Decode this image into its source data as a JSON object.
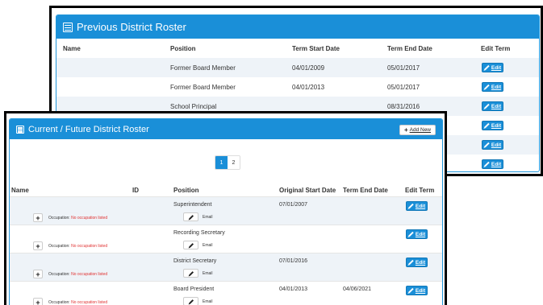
{
  "previous_roster": {
    "title": "Previous District Roster",
    "columns": [
      "Name",
      "Position",
      "Term Start Date",
      "Term End Date",
      "Edit Term"
    ],
    "rows": [
      {
        "name": "",
        "position": "Former Board Member",
        "start": "04/01/2009",
        "end": "05/01/2017",
        "edit": "Edit"
      },
      {
        "name": "",
        "position": "Former Board Member",
        "start": "04/01/2013",
        "end": "05/01/2017",
        "edit": "Edit"
      },
      {
        "name": "",
        "position": "School Principal",
        "start": "",
        "end": "08/31/2016",
        "edit": "Edit"
      },
      {
        "edit": "Edit"
      },
      {
        "edit": "Edit"
      },
      {
        "edit": "Edit"
      }
    ]
  },
  "current_roster": {
    "title": "Current / Future District Roster",
    "add_new_label": "Add New",
    "pagination": [
      "1",
      "2"
    ],
    "columns": [
      "Name",
      "ID",
      "Position",
      "Original Start Date",
      "Term End Date",
      "Edit Term"
    ],
    "occupation_prefix": "Occupation:",
    "occupation_empty": "No occupation listed",
    "email_label": "Email",
    "rows": [
      {
        "position": "Superintendent",
        "start": "07/01/2007",
        "end": "",
        "edit": "Edit"
      },
      {
        "position": "Recording Secretary",
        "start": "",
        "end": "",
        "edit": "Edit"
      },
      {
        "position": "District Secretary",
        "start": "07/01/2016",
        "end": "",
        "edit": "Edit"
      },
      {
        "position": "Board President",
        "start": "04/01/2013",
        "end": "04/06/2021",
        "edit": "Edit"
      }
    ]
  },
  "colors": {
    "accent": "#1a8fd8",
    "stripe": "#eef3f8",
    "error": "#e03131"
  }
}
